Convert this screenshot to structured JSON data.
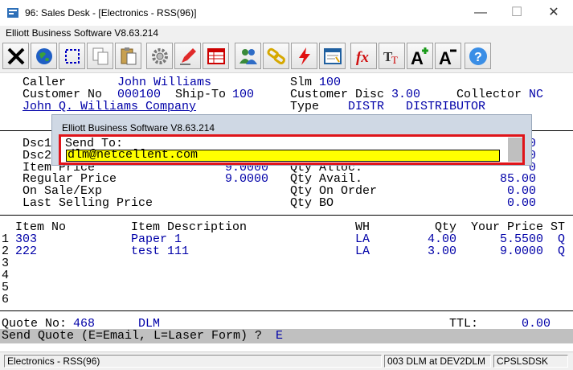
{
  "window": {
    "title": "96: Sales Desk - [Electronics - RSS(96)]",
    "subtitle": "Elliott Business Software V8.63.214",
    "min_glyph": "—",
    "max_glyph": "☐",
    "close_glyph": "✕"
  },
  "toolbar": {
    "buttons": [
      "close-x",
      "globe",
      "select",
      "copy",
      "paste",
      "settings",
      "edit",
      "table",
      "users",
      "link",
      "flash",
      "report",
      "function",
      "font",
      "font-increase",
      "font-decrease",
      "help"
    ]
  },
  "header": {
    "caller_label": "Caller",
    "caller_value": "John Williams",
    "slm_label": "Slm",
    "slm_value": "100",
    "customer_no_label": "Customer No",
    "customer_no_value": "000100",
    "ship_to_label": "Ship-To",
    "ship_to_value": "100",
    "customer_disc_label": "Customer Disc",
    "customer_disc_value": "3.00",
    "collector_label": "Collector",
    "collector_value": "NC",
    "company": "John Q. Williams Company",
    "type_label": "Type",
    "type_code": "DISTR",
    "type_desc": "DISTRIBUTOR"
  },
  "pricing": {
    "dsc1_label": "Dsc1",
    "dsc2_label": "Dsc2",
    "item_price_label": "Item Price",
    "item_price_value": "9.0000",
    "regular_price_label": "Regular Price",
    "regular_price_value": "9.0000",
    "on_sale_label": "On Sale/Exp",
    "last_selling_label": "Last Selling Price",
    "dsc1_value": "0",
    "dsc2_value": "0",
    "qty_alloc_label": "Qty Alloc.",
    "qty_alloc_value": "0",
    "qty_avail_label": "Qty Avail.",
    "qty_avail_value": "85.00",
    "qty_on_order_label": "Qty On Order",
    "qty_on_order_value": "0.00",
    "qty_bo_label": "Qty BO",
    "qty_bo_value": "0.00"
  },
  "lines": {
    "headers": {
      "item_no": "Item No",
      "desc": "Item Description",
      "wh": "WH",
      "qty": "Qty",
      "price": "Your Price",
      "st": "ST"
    },
    "rows": [
      {
        "n": "1",
        "item": "303",
        "desc": "Paper 1",
        "wh": "LA",
        "qty": "4.00",
        "price": "5.5500",
        "st": "Q"
      },
      {
        "n": "2",
        "item": "222",
        "desc": "test 111",
        "wh": "LA",
        "qty": "3.00",
        "price": "9.0000",
        "st": "Q"
      },
      {
        "n": "3"
      },
      {
        "n": "4"
      },
      {
        "n": "5"
      },
      {
        "n": "6"
      }
    ]
  },
  "footer": {
    "quote_label": "Quote No:",
    "quote_value": "468",
    "quote_user": "DLM",
    "ttl_label": "TTL:",
    "ttl_value": "0.00",
    "prompt": "Send Quote (E=Email, L=Laser Form) ?",
    "prompt_value": "E"
  },
  "dialog": {
    "title": "Elliott Business Software V8.63.214",
    "label": "Send To:",
    "value": "dlm@netcellent.com"
  },
  "statusbar": {
    "company": "Electronics - RSS(96)",
    "session": "003 DLM at DEV2DLM",
    "program": "CPSLSDSK"
  }
}
